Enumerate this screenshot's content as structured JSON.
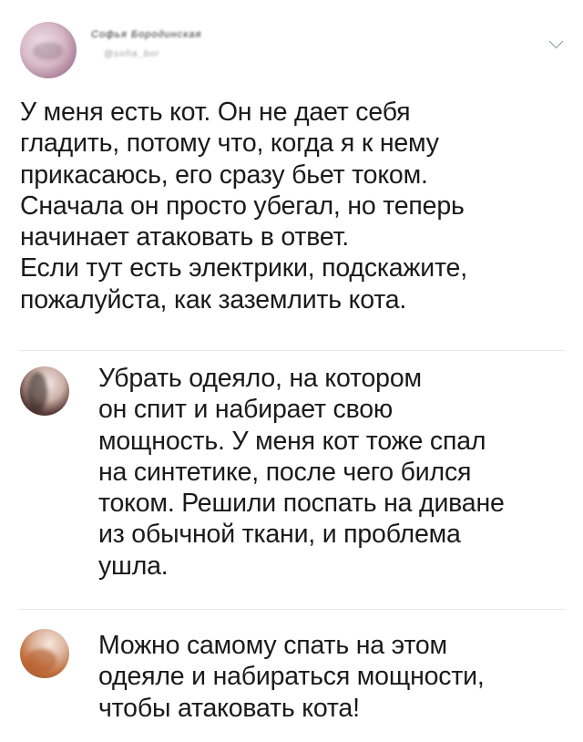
{
  "post": {
    "author_name": "Софья Бородинская",
    "author_handle": "@sofia_bor",
    "text": "У меня есть кот. Он не дает себя\nгладить, потому что, когда я к нему\nприкасаюсь, его сразу бьет током.\nСначала он просто убегал, но теперь\nначинает атаковать в ответ.\nЕсли тут есть электрики, подскажите,\nпожалуйста, как заземлить кота.",
    "menu_icon": "chevron-down-icon"
  },
  "replies": [
    {
      "avatar_icon": "user-avatar",
      "text": "Убрать одеяло, на котором\nон спит и набирает свою\nмощность. У меня кот тоже спал\nна синтетике, после чего бился\nтоком. Решили поспать на диване\nиз обычной ткани, и проблема\nушла."
    },
    {
      "avatar_icon": "user-avatar",
      "text": "Можно самому спать на этом\nодеяле и набираться мощности,\nчтобы атаковать кота!"
    }
  ],
  "colors": {
    "text": "#1a1a1a",
    "divider": "#e6e8eb",
    "chevron": "#8a8f98",
    "handle": "#9a9a9a"
  }
}
